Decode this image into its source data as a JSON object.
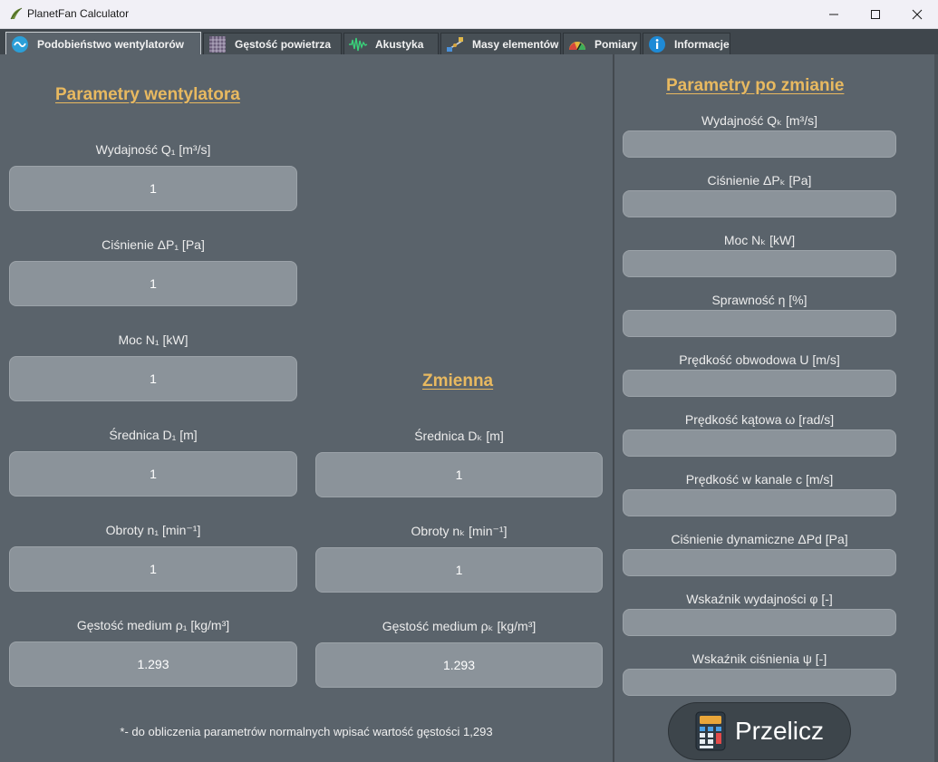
{
  "window": {
    "title": "PlanetFan Calculator"
  },
  "tabs": [
    {
      "label": "Podobieństwo wentylatorów",
      "icon": "similarity-icon",
      "active": true
    },
    {
      "label": "Gęstość powietrza",
      "icon": "grid-icon",
      "active": false
    },
    {
      "label": "Akustyka",
      "icon": "waveform-icon",
      "active": false
    },
    {
      "label": "Masy elementów",
      "icon": "scale-icon",
      "active": false
    },
    {
      "label": "Pomiary",
      "icon": "gauge-icon",
      "active": false
    },
    {
      "label": "Informacje",
      "icon": "info-icon",
      "active": false
    }
  ],
  "fan_params": {
    "heading": "Parametry wentylatora",
    "flow": {
      "label": "Wydajność Q₁ [m³/s]",
      "value": "1"
    },
    "pressure": {
      "label": "Ciśnienie ΔP₁ [Pa]",
      "value": "1"
    },
    "power": {
      "label": "Moc N₁ [kW]",
      "value": "1"
    },
    "diameter": {
      "label": "Średnica D₁ [m]",
      "value": "1"
    },
    "speed": {
      "label": "Obroty n₁ [min⁻¹]",
      "value": "1"
    },
    "density": {
      "label": "Gęstość medium ρ₁ [kg/m³]",
      "value": "1.293"
    }
  },
  "variable": {
    "heading": "Zmienna",
    "diameter": {
      "label": "Średnica Dₖ [m]",
      "value": "1"
    },
    "speed": {
      "label": "Obroty nₖ [min⁻¹]",
      "value": "1"
    },
    "density": {
      "label": "Gęstość medium ρₖ [kg/m³]",
      "value": "1.293"
    }
  },
  "results": {
    "heading": "Parametry po zmianie",
    "items": [
      {
        "label": "Wydajność Qₖ [m³/s]",
        "value": ""
      },
      {
        "label": "Ciśnienie ΔPₖ [Pa]",
        "value": ""
      },
      {
        "label": "Moc Nₖ [kW]",
        "value": ""
      },
      {
        "label": "Sprawność η [%]",
        "value": ""
      },
      {
        "label": "Prędkość obwodowa U [m/s]",
        "value": ""
      },
      {
        "label": "Prędkość kątowa ω [rad/s]",
        "value": ""
      },
      {
        "label": "Prędkość w kanale c [m/s]",
        "value": ""
      },
      {
        "label": "Ciśnienie dynamiczne ΔPd [Pa]",
        "value": ""
      },
      {
        "label": "Wskaźnik wydajności φ [-]",
        "value": ""
      },
      {
        "label": "Wskaźnik ciśnienia ψ [-]",
        "value": ""
      }
    ]
  },
  "footnote": "*- do obliczenia parametrów normalnych wpisać wartość gęstości 1,293",
  "calculate_button": {
    "label": "Przelicz",
    "icon": "calculator-icon"
  },
  "colors": {
    "accent_heading": "#e8b960",
    "background": "#5a636b",
    "field": "#8b939a"
  }
}
